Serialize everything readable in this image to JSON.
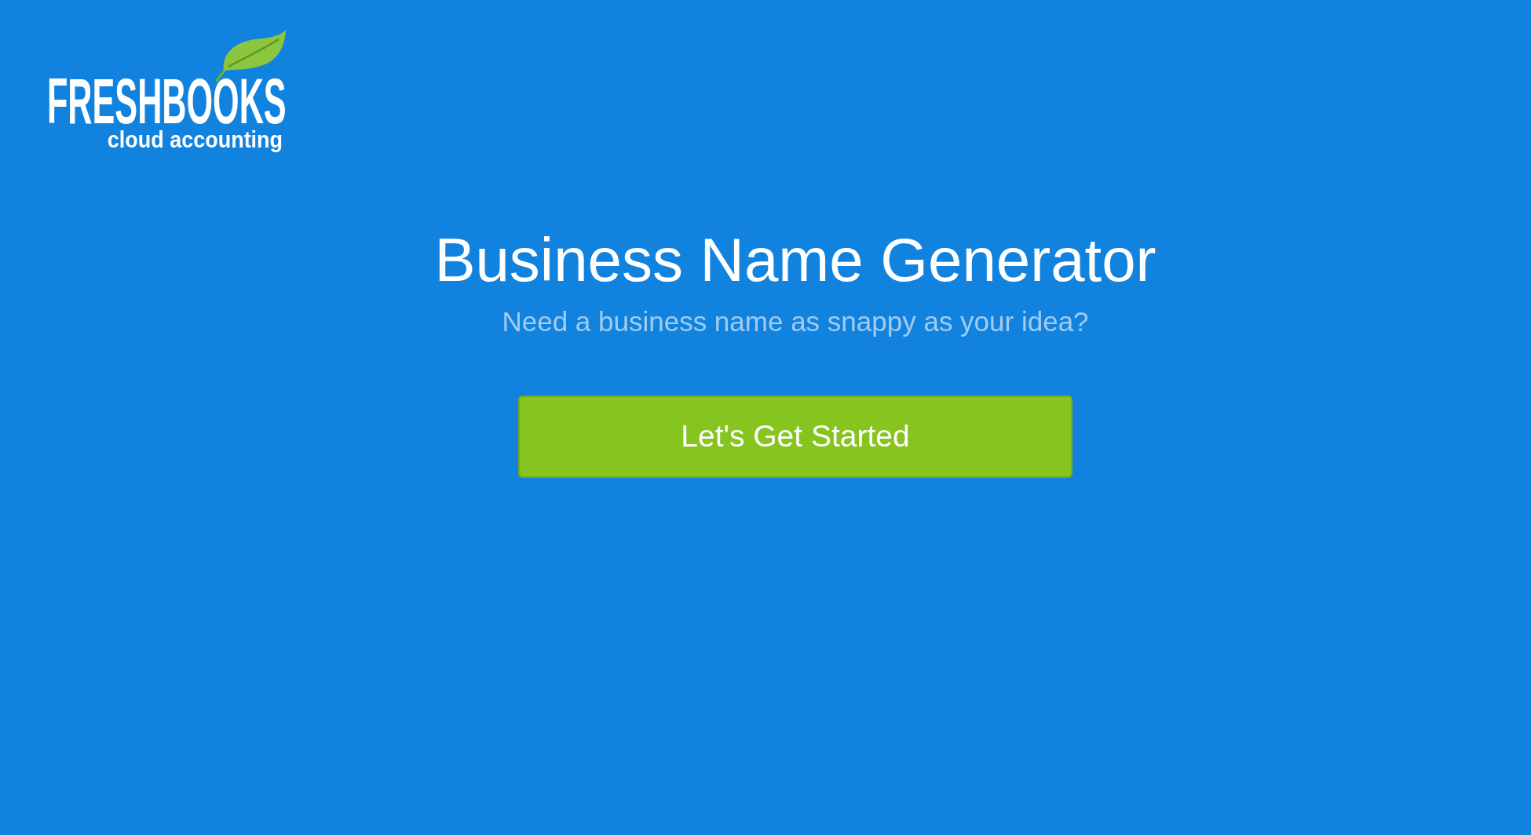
{
  "logo": {
    "wordmark": "FRESHBOOKS",
    "tagline": "cloud accounting"
  },
  "hero": {
    "title": "Business Name Generator",
    "subtitle": "Need a business name as snappy as your idea?",
    "button": "Let's Get Started"
  }
}
